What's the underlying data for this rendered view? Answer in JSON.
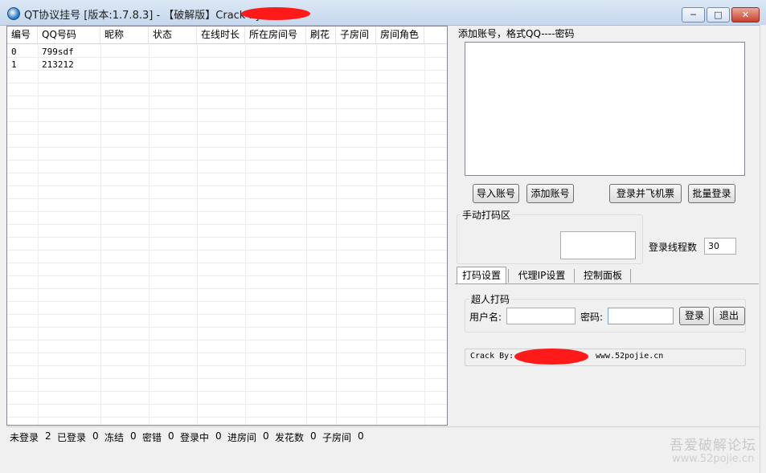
{
  "window": {
    "title": "QT协议挂号 [版本:1.7.8.3] - 【破解版】Crack by",
    "min_glyph": "─",
    "max_glyph": "□",
    "close_glyph": "✕"
  },
  "grid": {
    "columns": [
      "编号",
      "QQ号码",
      "昵称",
      "状态",
      "在线时长",
      "所在房间号",
      "刷花",
      "子房间",
      "房间角色"
    ],
    "rows": [
      {
        "id": "0",
        "qq": "799sdf"
      },
      {
        "id": "1",
        "qq": "213212"
      }
    ]
  },
  "accounts": {
    "label": "添加账号，格式QQ----密码",
    "textarea_value": ""
  },
  "buttons": {
    "import": "导入账号",
    "add": "添加账号",
    "login_ticket": "登录并飞机票",
    "batch_login": "批量登录"
  },
  "captcha_area": {
    "title": "手动打码区",
    "thread_label": "登录线程数",
    "thread_value": "30"
  },
  "tabs": [
    {
      "label": "打码设置",
      "active": true
    },
    {
      "label": "代理IP设置",
      "active": false
    },
    {
      "label": "控制面板",
      "active": false
    }
  ],
  "captcha_settings": {
    "group_title": "超人打码",
    "username_label": "用户名:",
    "username_value": "",
    "password_label": "密码:",
    "password_value": "",
    "login_button": "登录",
    "exit_button": "退出"
  },
  "credit": {
    "prefix": "Crack By:",
    "site": "www.52pojie.cn"
  },
  "status": [
    {
      "label": "未登录",
      "value": "2"
    },
    {
      "label": "已登录",
      "value": "0"
    },
    {
      "label": "冻结",
      "value": "0"
    },
    {
      "label": "密错",
      "value": "0"
    },
    {
      "label": "登录中",
      "value": "0"
    },
    {
      "label": "进房间",
      "value": "0"
    },
    {
      "label": "发花数",
      "value": "0"
    },
    {
      "label": "子房间",
      "value": "0"
    }
  ],
  "watermark": {
    "line1": "吾爱破解论坛",
    "line2": "www.52pojie.cn"
  },
  "colors": {
    "redaction": "#ff1a1a",
    "title_bar": "#c6d8ee"
  }
}
